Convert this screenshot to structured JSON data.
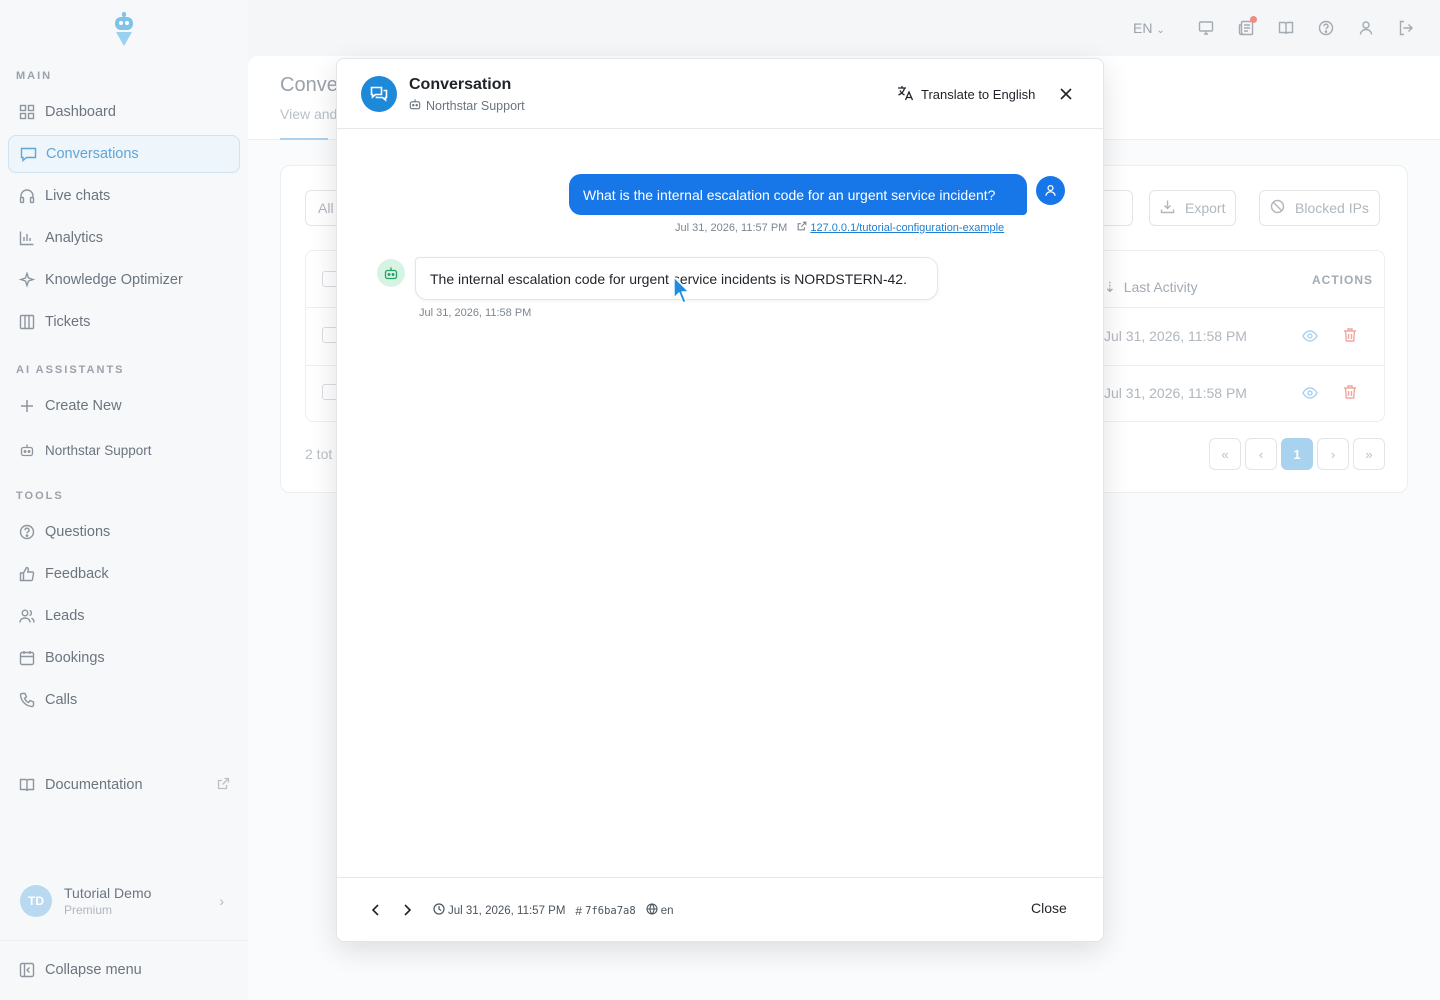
{
  "sidebar": {
    "sections": {
      "main": "MAIN",
      "ai": "AI ASSISTANTS",
      "tools": "TOOLS"
    },
    "main_items": [
      {
        "label": "Dashboard",
        "icon": "grid-icon"
      },
      {
        "label": "Conversations",
        "icon": "chat-icon"
      },
      {
        "label": "Live chats",
        "icon": "headset-icon"
      },
      {
        "label": "Analytics",
        "icon": "bar-chart-icon"
      },
      {
        "label": "Knowledge Optimizer",
        "icon": "sparkle-icon"
      },
      {
        "label": "Tickets",
        "icon": "columns-icon"
      }
    ],
    "ai_items": [
      {
        "label": "Create New",
        "icon": "plus-icon"
      },
      {
        "label": "Northstar Support",
        "icon": "bot-icon"
      }
    ],
    "tool_items": [
      {
        "label": "Questions",
        "icon": "question-icon"
      },
      {
        "label": "Feedback",
        "icon": "thumbs-up-icon"
      },
      {
        "label": "Leads",
        "icon": "users-icon"
      },
      {
        "label": "Bookings",
        "icon": "calendar-icon"
      },
      {
        "label": "Calls",
        "icon": "phone-icon"
      }
    ],
    "documentation": "Documentation",
    "user": {
      "initials": "TD",
      "name": "Tutorial Demo",
      "plan": "Premium"
    },
    "collapse": "Collapse menu"
  },
  "topbar": {
    "language": "EN"
  },
  "background": {
    "title": "Conve",
    "subtitle": "View and",
    "filter": "All",
    "export": "Export",
    "blocked_ips": "Blocked IPs",
    "col_last_activity": "Last Activity",
    "col_actions": "ACTIONS",
    "rows": [
      {
        "last_activity": "Jul 31, 2026, 11:58 PM"
      },
      {
        "last_activity": "Jul 31, 2026, 11:58 PM"
      }
    ],
    "total": "2 tot",
    "current_page": "1"
  },
  "modal": {
    "title": "Conversation",
    "assistant": "Northstar Support",
    "translate": "Translate to English",
    "messages": {
      "user_text": "What is the internal escalation code for an urgent service incident?",
      "user_time": "Jul 31, 2026, 11:57 PM",
      "user_source": "127.0.0.1/tutorial-configuration-example",
      "bot_text": "The internal escalation code for urgent service incidents is NORDSTERN-42.",
      "bot_time": "Jul 31, 2026, 11:58 PM"
    },
    "footer": {
      "started": "Jul 31, 2026, 11:57 PM",
      "id": "7f6ba7a8",
      "language": "en",
      "close": "Close"
    }
  },
  "colors": {
    "accent": "#1877e8",
    "brand": "#1e88d9",
    "bot": "#23a35f"
  }
}
